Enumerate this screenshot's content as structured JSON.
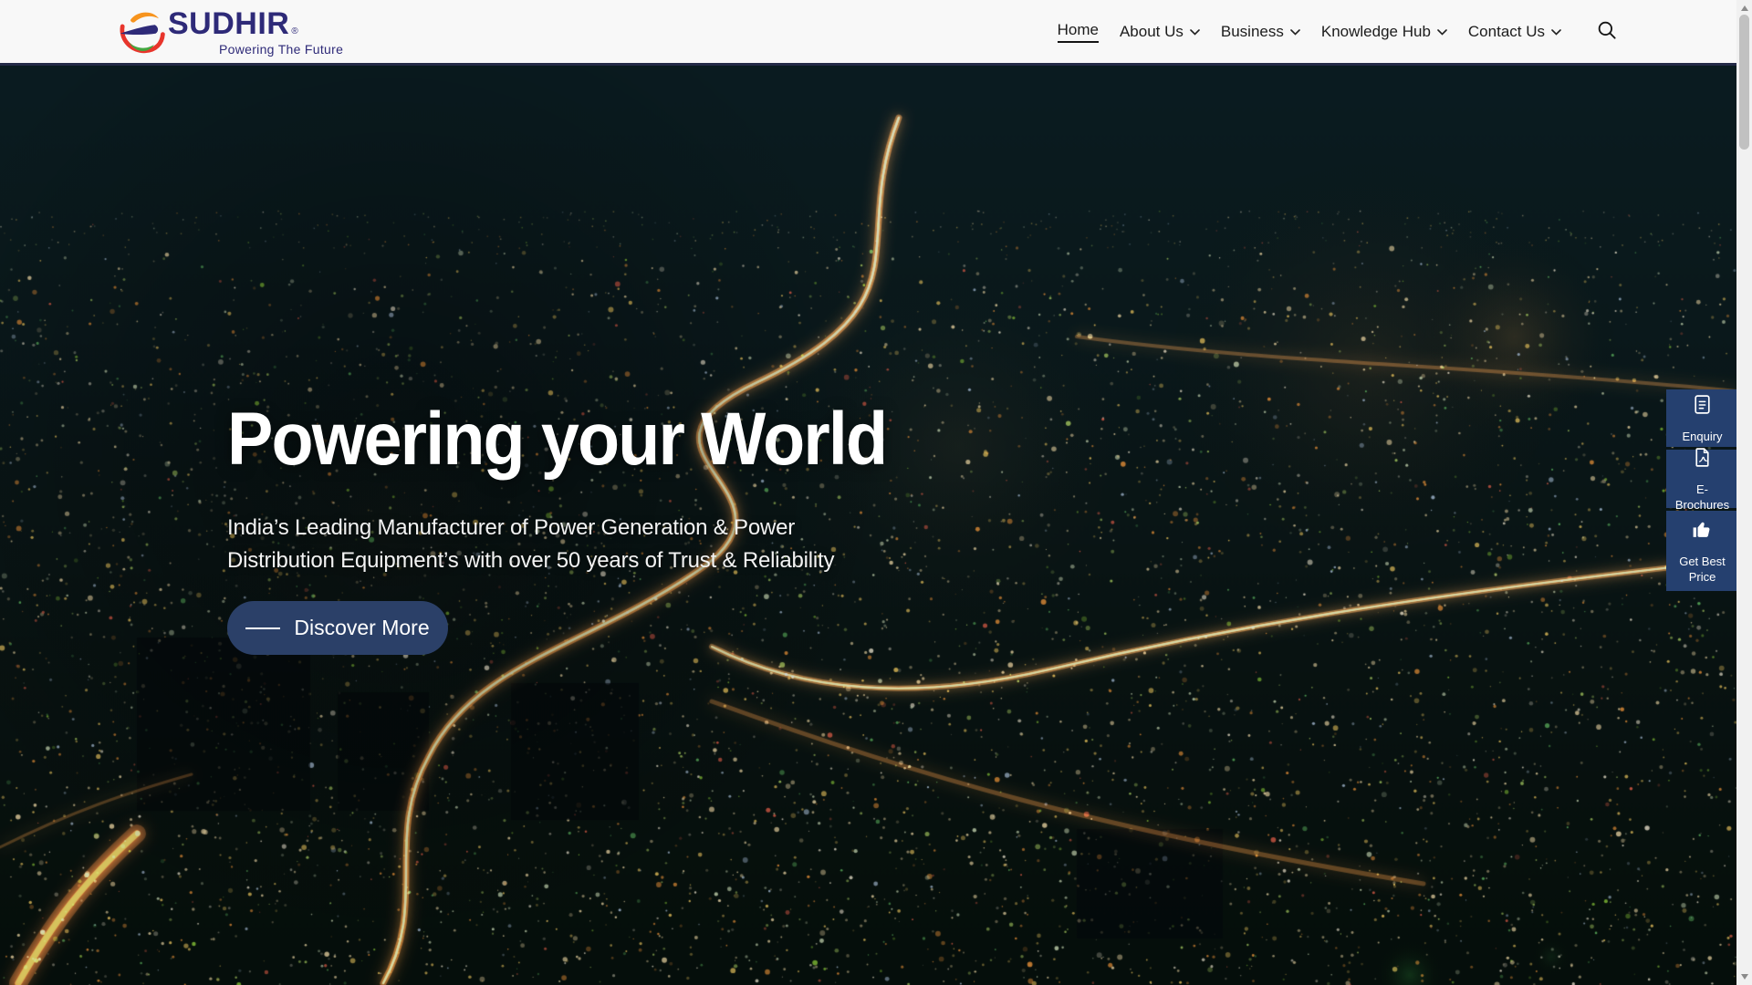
{
  "brand": {
    "name": "SUDHIR",
    "registered_mark": "®",
    "tagline": "Powering The Future",
    "logo_colors": {
      "orange": "#F7941E",
      "red": "#E8352C",
      "navy": "#2E2A78",
      "green": "#43A63F"
    }
  },
  "nav": {
    "items": [
      {
        "label": "Home",
        "active": true,
        "has_dropdown": false
      },
      {
        "label": "About Us",
        "active": false,
        "has_dropdown": true
      },
      {
        "label": "Business",
        "active": false,
        "has_dropdown": true
      },
      {
        "label": "Knowledge Hub",
        "active": false,
        "has_dropdown": true
      },
      {
        "label": "Contact Us",
        "active": false,
        "has_dropdown": true
      }
    ],
    "search_icon": "search-icon"
  },
  "hero": {
    "heading": "Powering your World",
    "subheading_lines": [
      "India’s Leading Manufacturer of Power Generation & Power",
      "Distribution Equipment’s with over 50 years of Trust & Reliability"
    ],
    "cta_label": "Discover More"
  },
  "floating_actions": [
    {
      "label": "Enquiry",
      "icon": "document-lines-icon"
    },
    {
      "label": "E-Brochures",
      "icon": "pdf-file-icon"
    },
    {
      "label": "Get Best Price",
      "icon": "thumbs-up-icon"
    }
  ],
  "colors": {
    "header_bg": "#F8F8F8",
    "brand_navy": "#2E2A78",
    "cta_navy": "#2B4068",
    "action_panel_navy": "#25406F",
    "hero_top_line": "#242A47",
    "hero_base": "#0B1B1F",
    "scrollbar_track": "#F1F1F1",
    "scrollbar_thumb": "#C1C1C1"
  }
}
